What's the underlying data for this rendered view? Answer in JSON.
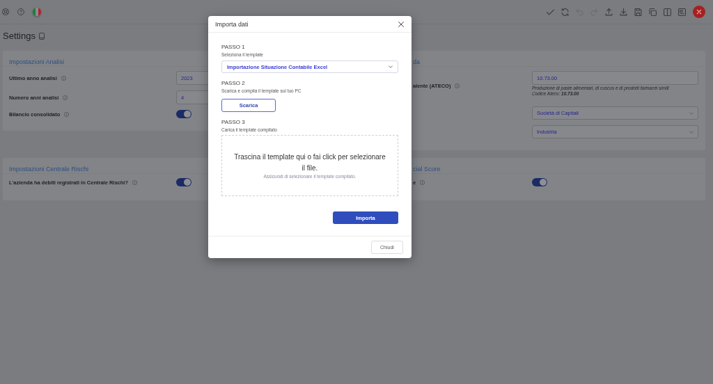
{
  "top_bar": {
    "left_tools": [
      {
        "kind": "lifebuoy"
      },
      {
        "kind": "help"
      },
      {
        "kind": "flag"
      }
    ],
    "right_tools": [
      {
        "kind": "check",
        "disabled": false
      },
      {
        "kind": "refresh",
        "disabled": false
      },
      {
        "kind": "undo",
        "disabled": true
      },
      {
        "kind": "redo",
        "disabled": true
      },
      {
        "kind": "upload",
        "disabled": false
      },
      {
        "kind": "download",
        "disabled": false
      },
      {
        "kind": "save",
        "disabled": false
      },
      {
        "kind": "copy",
        "disabled": false
      },
      {
        "kind": "columns",
        "disabled": false
      },
      {
        "kind": "layout",
        "disabled": false
      },
      {
        "kind": "close",
        "disabled": false
      }
    ]
  },
  "page": {
    "title": "Settings"
  },
  "cards": [
    {
      "title": "Impostazioni Analisi",
      "rows": [
        {
          "kind": "input",
          "label": "Ultimo anno analisi",
          "value": "2023"
        },
        {
          "kind": "input",
          "label": "Numero anni analisi",
          "value": "4"
        },
        {
          "kind": "toggle",
          "label": "Bilancio consolidato",
          "on": true
        }
      ]
    },
    {
      "title": "da",
      "rows": [
        {
          "kind": "input",
          "label": "alente (ATECO)",
          "value": "10.73.00",
          "help": "Produzione di paste alimentari, di cuscus e di prodotti farinacei simili",
          "note": "Codice Ateco: **10.73.00**"
        },
        {
          "kind": "select",
          "value": "Società di Capitali"
        },
        {
          "kind": "select",
          "value": "Industria"
        }
      ]
    },
    {
      "title": "Impostazioni Centrale Rischi",
      "rows": [
        {
          "kind": "toggle",
          "label": "L'azienda ha debiti registrati in Centrale Rischi?",
          "on": true
        }
      ]
    },
    {
      "title": "cial Score",
      "rows": [
        {
          "kind": "toggle",
          "label": "e",
          "on": true
        }
      ]
    }
  ],
  "dialog": {
    "title": "Importa dati",
    "steps": [
      {
        "heading": "PASSO 1",
        "text": "Seleziona il template",
        "kind": "select",
        "value": "Importazione Situazione Contabile Excel"
      },
      {
        "heading": "PASSO 2",
        "text": "Scarica e compila il template sul tuo PC",
        "kind": "button",
        "label": "Scarica"
      },
      {
        "heading": "PASSO 3",
        "text": "Carica il template compilato",
        "kind": "dropzone",
        "title": "Trascina il template qui o fai click per selezionare il file.",
        "hint": "Assicurati di selezionare il template compilato."
      }
    ],
    "primary_button": "Importa",
    "footer_button": "Chiudi"
  }
}
